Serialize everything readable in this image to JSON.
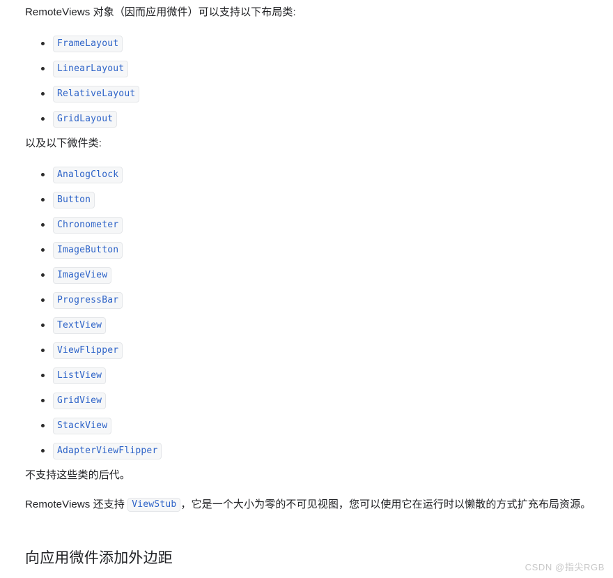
{
  "document": {
    "intro_paragraph": "RemoteViews 对象（因而应用微件）可以支持以下布局类:",
    "widgets_intro_paragraph": "以及以下微件类:",
    "no_descendants_paragraph": "不支持这些类的后代。",
    "viewstub_paragraph": {
      "before_code": "RemoteViews 还支持 ",
      "code": "ViewStub",
      "after_code": "，它是一个大小为零的不可见视图，您可以使用它在运行时以懒散的方式扩充布局资源。"
    },
    "section_heading": "向应用微件添加外边距",
    "watermark": "CSDN @指尖RGB"
  },
  "layout_classes": [
    {
      "name": "FrameLayout"
    },
    {
      "name": "LinearLayout"
    },
    {
      "name": "RelativeLayout"
    },
    {
      "name": "GridLayout"
    }
  ],
  "widget_classes": [
    {
      "name": "AnalogClock"
    },
    {
      "name": "Button"
    },
    {
      "name": "Chronometer"
    },
    {
      "name": "ImageButton"
    },
    {
      "name": "ImageView"
    },
    {
      "name": "ProgressBar"
    },
    {
      "name": "TextView"
    },
    {
      "name": "ViewFlipper"
    },
    {
      "name": "ListView"
    },
    {
      "name": "GridView"
    },
    {
      "name": "StackView"
    },
    {
      "name": "AdapterViewFlipper"
    }
  ],
  "colors": {
    "page_background": "#ffffff",
    "body_text": "#202124",
    "code_text": "#2d63c8",
    "code_background": "#f6f7f8",
    "code_border": "#e4e6e9",
    "bullet": "#2b2b2b",
    "watermark": "#c8c8c8"
  }
}
